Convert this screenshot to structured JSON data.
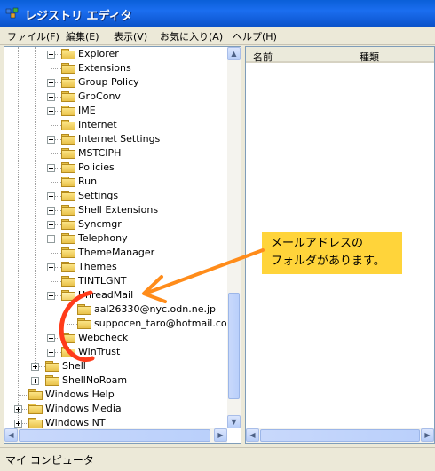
{
  "window": {
    "title": "レジストリ エディタ"
  },
  "menu": [
    "ファイル(F)",
    "編集(E)",
    "表示(V)",
    "お気に入り(A)",
    "ヘルプ(H)"
  ],
  "tree": [
    {
      "label": "Explorer",
      "expander": "plus"
    },
    {
      "label": "Extensions",
      "expander": "none"
    },
    {
      "label": "Group Policy",
      "expander": "plus"
    },
    {
      "label": "GrpConv",
      "expander": "plus"
    },
    {
      "label": "IME",
      "expander": "plus"
    },
    {
      "label": "Internet",
      "expander": "none"
    },
    {
      "label": "Internet Settings",
      "expander": "plus"
    },
    {
      "label": "MSTCIPH",
      "expander": "none"
    },
    {
      "label": "Policies",
      "expander": "plus"
    },
    {
      "label": "Run",
      "expander": "none"
    },
    {
      "label": "Settings",
      "expander": "plus"
    },
    {
      "label": "Shell Extensions",
      "expander": "plus"
    },
    {
      "label": "Syncmgr",
      "expander": "plus"
    },
    {
      "label": "Telephony",
      "expander": "plus"
    },
    {
      "label": "ThemeManager",
      "expander": "none"
    },
    {
      "label": "Themes",
      "expander": "plus"
    },
    {
      "label": "TINTLGNT",
      "expander": "none"
    },
    {
      "label": "UnreadMail",
      "expander": "minus"
    },
    {
      "label": "aal26330@nyc.odn.ne.jp",
      "expander": "none"
    },
    {
      "label": "suppocen_taro@hotmail.com",
      "expander": "none"
    },
    {
      "label": "Webcheck",
      "expander": "plus"
    },
    {
      "label": "WinTrust",
      "expander": "plus"
    },
    {
      "label": "Shell",
      "expander": "plus"
    },
    {
      "label": "ShellNoRoam",
      "expander": "plus"
    },
    {
      "label": "Windows Help",
      "expander": "none"
    },
    {
      "label": "Windows Media",
      "expander": "plus"
    },
    {
      "label": "Windows NT",
      "expander": "plus"
    }
  ],
  "list": {
    "columns": [
      "名前",
      "種類"
    ]
  },
  "callout": {
    "line1": "メールアドレスの",
    "line2": "フォルダがあります。"
  },
  "status": "マイ コンピュータ",
  "colors": {
    "title_bar": "#0a5fd8",
    "callout_bg": "#ffd43a",
    "annotation": "#ff8c1a",
    "circle": "#ff3b1a"
  }
}
